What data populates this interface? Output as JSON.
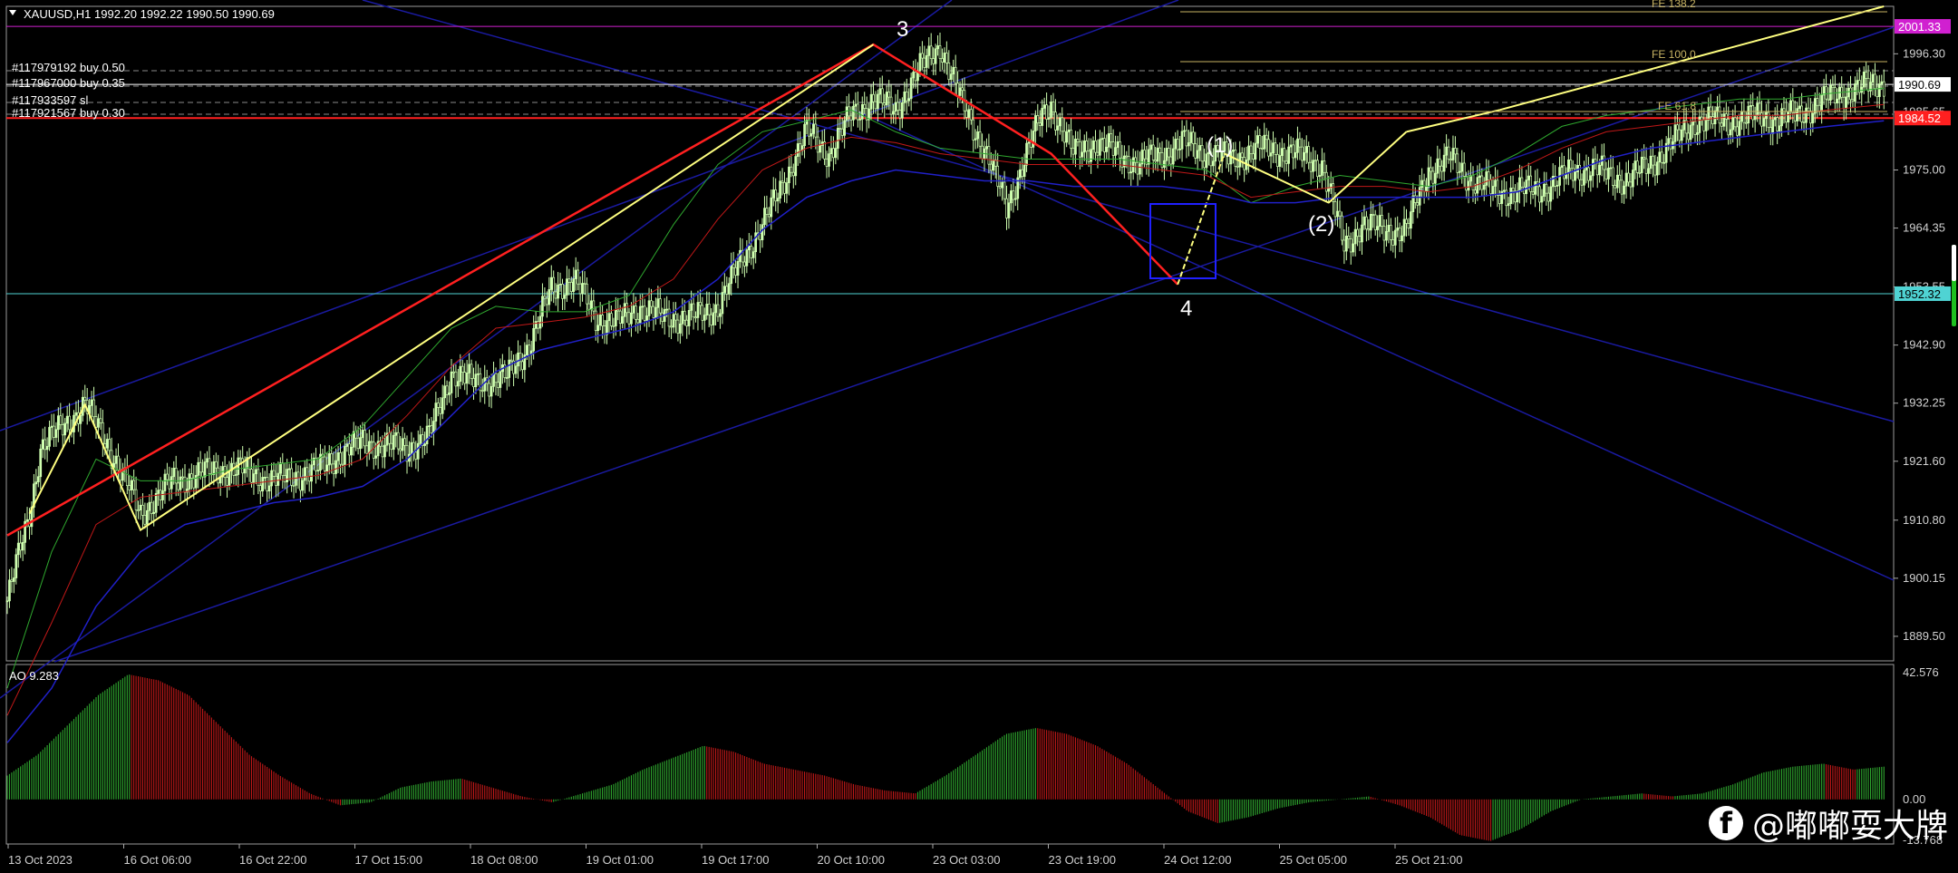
{
  "symbol_header": "XAUUSD,H1  1992.20 1992.22 1990.50 1990.69",
  "orders": [
    "#117979192 buy 0.50",
    "#117967000 buy 0.35",
    "#117933597 sl",
    "#117921567 buy 0.30"
  ],
  "wave_labels": {
    "w3": "3",
    "w4": "4",
    "wi": "(1)",
    "wii": "(2)"
  },
  "fibo_labels": {
    "fe1382": "FE 138.2",
    "fe100": "FE 100.0",
    "fe618": "FE 61.8"
  },
  "price_badges": {
    "magenta": "2001.33",
    "current": "1990.69",
    "red": "1984.52",
    "cyan": "1952.32"
  },
  "ao_label": "AO 9.283",
  "watermark": "@嘟嘟耍大牌",
  "chart_data": {
    "type": "line",
    "title": "XAUUSD,H1",
    "ylim": [
      1885.0,
      2005.0
    ],
    "yticks": [
      "1996.30",
      "1985.65",
      "1975.00",
      "1964.35",
      "1953.55",
      "1942.90",
      "1932.25",
      "1921.60",
      "1910.80",
      "1900.15",
      "1889.50"
    ],
    "xticks": [
      "13 Oct 2023",
      "16 Oct 06:00",
      "16 Oct 22:00",
      "17 Oct 15:00",
      "18 Oct 08:00",
      "19 Oct 01:00",
      "19 Oct 17:00",
      "20 Oct 10:00",
      "23 Oct 03:00",
      "23 Oct 19:00",
      "24 Oct 12:00",
      "25 Oct 05:00",
      "25 Oct 21:00"
    ],
    "price_path": {
      "x": [
        0,
        10,
        15,
        35,
        45,
        60,
        75,
        95,
        105,
        120,
        140,
        150,
        160,
        180,
        190,
        200,
        210,
        225,
        235,
        245,
        255,
        265,
        275,
        285,
        295,
        300,
        310,
        320,
        330,
        343,
        360,
        370,
        380,
        390,
        400,
        410,
        420,
        430,
        440,
        450,
        458,
        466,
        470,
        480,
        490,
        500,
        510,
        520,
        530,
        540,
        550,
        565,
        580,
        592,
        602,
        610,
        620,
        630,
        640,
        650,
        660,
        670,
        680,
        695,
        705,
        715,
        730,
        745,
        760,
        780,
        790,
        797,
        805,
        815,
        825,
        835,
        845
      ],
      "y": [
        1896,
        1912,
        1924,
        1932,
        1925,
        1912,
        1918,
        1920,
        1920,
        1918,
        1920,
        1923,
        1925,
        1924,
        1926,
        1938,
        1936,
        1937,
        1943,
        1953,
        1955,
        1948,
        1947,
        1950,
        1948,
        1948,
        1948,
        1950,
        1958,
        1967,
        1982,
        1978,
        1985,
        1988,
        1986,
        1993,
        1998,
        1987,
        1979,
        1968,
        1977,
        1985,
        1987,
        1978,
        1980,
        1978,
        1976,
        1978,
        1980,
        1978,
        1977,
        1979,
        1978,
        1976,
        1961,
        1965,
        1964,
        1964,
        1975,
        1977,
        1973,
        1971,
        1971,
        1972,
        1975,
        1975,
        1973,
        1978,
        1984,
        1984,
        1985,
        1984,
        1985,
        1987,
        1989,
        1990,
        1991
      ]
    },
    "ma_fast": {
      "x": [
        0,
        20,
        40,
        60,
        80,
        100,
        120,
        140,
        160,
        180,
        200,
        220,
        240,
        260,
        280,
        300,
        320,
        340,
        360,
        380,
        400,
        420,
        440,
        460,
        480,
        500,
        520,
        540,
        560,
        580,
        600,
        620,
        640,
        660,
        680,
        700,
        720,
        740,
        760,
        780,
        800,
        820,
        845
      ],
      "y": [
        1880,
        1905,
        1922,
        1918,
        1918,
        1920,
        1921,
        1922,
        1928,
        1937,
        1946,
        1950,
        1949,
        1949,
        1952,
        1965,
        1976,
        1982,
        1984,
        1986,
        1982,
        1979,
        1978,
        1977,
        1977,
        1977,
        1976,
        1975,
        1969,
        1972,
        1974,
        1973,
        1972,
        1974,
        1978,
        1983,
        1985,
        1986,
        1987,
        1988,
        1988,
        1989,
        1990
      ]
    },
    "ma_mid": {
      "x": [
        0,
        20,
        40,
        60,
        80,
        100,
        120,
        140,
        160,
        180,
        200,
        220,
        240,
        260,
        280,
        300,
        320,
        340,
        360,
        380,
        400,
        420,
        440,
        460,
        480,
        500,
        520,
        540,
        560,
        580,
        600,
        620,
        640,
        660,
        680,
        700,
        720,
        740,
        760,
        780,
        800,
        820,
        845
      ],
      "y": [
        1875,
        1892,
        1910,
        1915,
        1916,
        1917,
        1918,
        1919,
        1922,
        1930,
        1939,
        1946,
        1947,
        1948,
        1950,
        1955,
        1966,
        1975,
        1979,
        1981,
        1980,
        1978,
        1977,
        1976,
        1976,
        1976,
        1975,
        1974,
        1970,
        1971,
        1972,
        1972,
        1971,
        1972,
        1975,
        1979,
        1982,
        1983,
        1984,
        1985,
        1985,
        1986,
        1987
      ]
    },
    "ma_slow": {
      "x": [
        0,
        20,
        40,
        60,
        80,
        100,
        120,
        140,
        160,
        180,
        200,
        220,
        240,
        260,
        280,
        300,
        320,
        340,
        360,
        380,
        400,
        420,
        440,
        460,
        480,
        500,
        520,
        540,
        560,
        580,
        600,
        620,
        640,
        660,
        680,
        700,
        720,
        740,
        760,
        780,
        800,
        820,
        845
      ],
      "y": [
        1870,
        1880,
        1895,
        1905,
        1910,
        1912,
        1914,
        1915,
        1917,
        1922,
        1930,
        1938,
        1942,
        1944,
        1946,
        1949,
        1955,
        1964,
        1970,
        1973,
        1975,
        1974,
        1973,
        1973,
        1972,
        1972,
        1972,
        1971,
        1969,
        1969,
        1970,
        1970,
        1970,
        1970,
        1971,
        1974,
        1977,
        1979,
        1980,
        1981,
        1982,
        1983,
        1984
      ]
    },
    "zigzag_red": {
      "x": [
        0,
        390,
        470,
        527
      ],
      "y": [
        1908,
        1998,
        1978,
        1954
      ]
    },
    "zigzag_yellow": {
      "x": [
        10,
        35,
        60,
        390
      ],
      "y": [
        1912,
        1932,
        1909,
        1998
      ]
    },
    "wave_minor": {
      "x": [
        527,
        548,
        595,
        630,
        672,
        845
      ],
      "y": [
        1954,
        1978,
        1969,
        1982,
        1986,
        2005
      ]
    },
    "hlines": [
      {
        "price": 1952.32,
        "label": "1952.32",
        "color": "#4fd3d3"
      },
      {
        "price": 1984.52,
        "label": "1984.52",
        "color": "#ff2020"
      },
      {
        "price": 1990.69,
        "label": "1990.69",
        "color": "#ffffff"
      },
      {
        "price": 2001.33,
        "label": "2001.33",
        "color": "#d020d0"
      }
    ],
    "ao": {
      "ylim": [
        -13.768,
        42.576
      ],
      "yticks": [
        "42.576",
        "0.00",
        "-13.768"
      ],
      "values": [
        8,
        15,
        25,
        35,
        42,
        40,
        35,
        25,
        15,
        8,
        2,
        -2,
        -1,
        4,
        6,
        7,
        4,
        1,
        -1,
        2,
        5,
        10,
        14,
        18,
        16,
        12,
        10,
        8,
        5,
        3,
        2,
        8,
        15,
        22,
        24,
        22,
        18,
        12,
        4,
        -4,
        -8,
        -6,
        -3,
        -1,
        0,
        1,
        -2,
        -6,
        -12,
        -14,
        -10,
        -4,
        0,
        1,
        2,
        1,
        2,
        5,
        9,
        11,
        12,
        10,
        11
      ]
    }
  }
}
